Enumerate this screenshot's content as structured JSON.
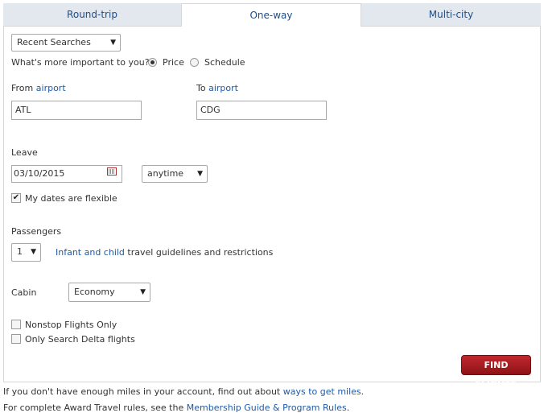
{
  "tabs": [
    {
      "label": "Round-trip",
      "active": false
    },
    {
      "label": "One-way",
      "active": true
    },
    {
      "label": "Multi-city",
      "active": false
    }
  ],
  "recent_searches": {
    "selected": "Recent Searches"
  },
  "preference": {
    "question": "What's more important to you?",
    "options": [
      {
        "label": "Price",
        "checked": true
      },
      {
        "label": "Schedule",
        "checked": false
      }
    ]
  },
  "from": {
    "label_prefix": "From",
    "label_link": "airport",
    "value": "ATL"
  },
  "to": {
    "label_prefix": "To",
    "label_link": "airport",
    "value": "CDG"
  },
  "leave": {
    "label": "Leave",
    "date": "03/10/2015",
    "time": "anytime"
  },
  "flexible": {
    "label": "My dates are flexible",
    "checked": true
  },
  "passengers": {
    "label": "Passengers",
    "count": "1",
    "guidelines_link": "Infant and child",
    "guidelines_text": "travel guidelines and restrictions"
  },
  "cabin": {
    "label": "Cabin",
    "selected": "Economy"
  },
  "filters": [
    {
      "label": "Nonstop Flights Only",
      "checked": false
    },
    {
      "label": "Only Search Delta flights",
      "checked": false
    }
  ],
  "find_button": "FIND FLIGHTS",
  "footer": {
    "line1_text": "If you don't have enough miles in your account, find out about",
    "line1_link": "ways to get miles",
    "line1_end": ".",
    "line2_text": "For complete Award Travel rules, see the",
    "line2_link": "Membership Guide & Program Rules",
    "line2_end": "."
  },
  "colors": {
    "accent": "#1f5aa6",
    "button": "#a81c22",
    "tab_bg": "#e3e8ee"
  }
}
